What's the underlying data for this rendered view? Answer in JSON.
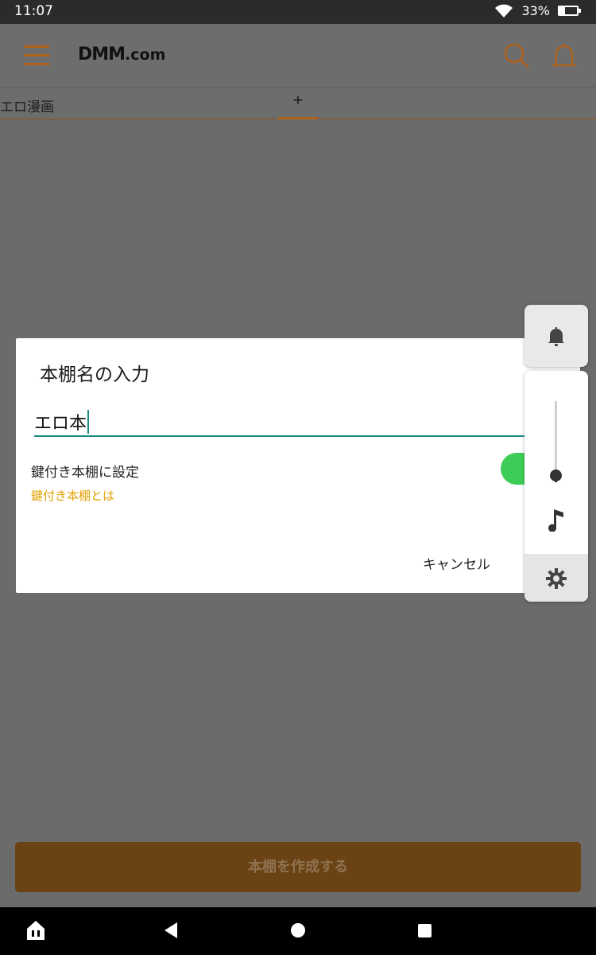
{
  "status": {
    "time": "11:07",
    "battery": "33%",
    "battery_level": 0.33
  },
  "header": {
    "logo_main": "DMM",
    "logo_suffix": ".com"
  },
  "tabs": [
    {
      "label": "エロ漫画"
    },
    {
      "label": "+"
    }
  ],
  "dialog": {
    "title": "本棚名の入力",
    "name_value": "エロ本",
    "lock_label": "鍵付き本棚に設定",
    "lock_link": "鍵付き本棚とは",
    "toggle_on": true,
    "cancel_label": "キャンセル"
  },
  "create_button": {
    "label": "本棚を作成する"
  },
  "volume_panel": {
    "level": 0.05
  },
  "colors": {
    "accent": "#b0621b",
    "toggle": "#3dcc55",
    "input_underline": "#1b8a80",
    "link": "#e2a000"
  },
  "icons": [
    "menu-icon",
    "search-icon",
    "bell-icon",
    "music-note-icon",
    "gear-icon",
    "home-icon",
    "back-icon",
    "home-circle-icon",
    "recents-icon"
  ]
}
